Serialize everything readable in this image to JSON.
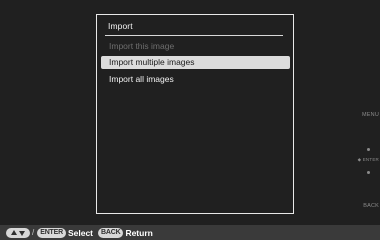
{
  "menu": {
    "title": "Import",
    "items": [
      {
        "label": "Import this image",
        "state": "disabled"
      },
      {
        "label": "Import multiple images",
        "state": "selected"
      },
      {
        "label": "Import all images",
        "state": "normal"
      }
    ]
  },
  "side_controls": {
    "menu_label": "MENU",
    "enter_label": "ENTER",
    "back_label": "BACK"
  },
  "bottom_bar": {
    "nav_icon": "up-down-arrows-icon",
    "separator": "/",
    "enter_key": "ENTER",
    "select_label": "Select",
    "back_key": "BACK",
    "return_label": "Return"
  },
  "colors": {
    "background": "#202020",
    "selected_highlight": "#dcdcdc",
    "disabled_text": "#6e6e6e",
    "bottom_bar": "#3a3a3a"
  }
}
